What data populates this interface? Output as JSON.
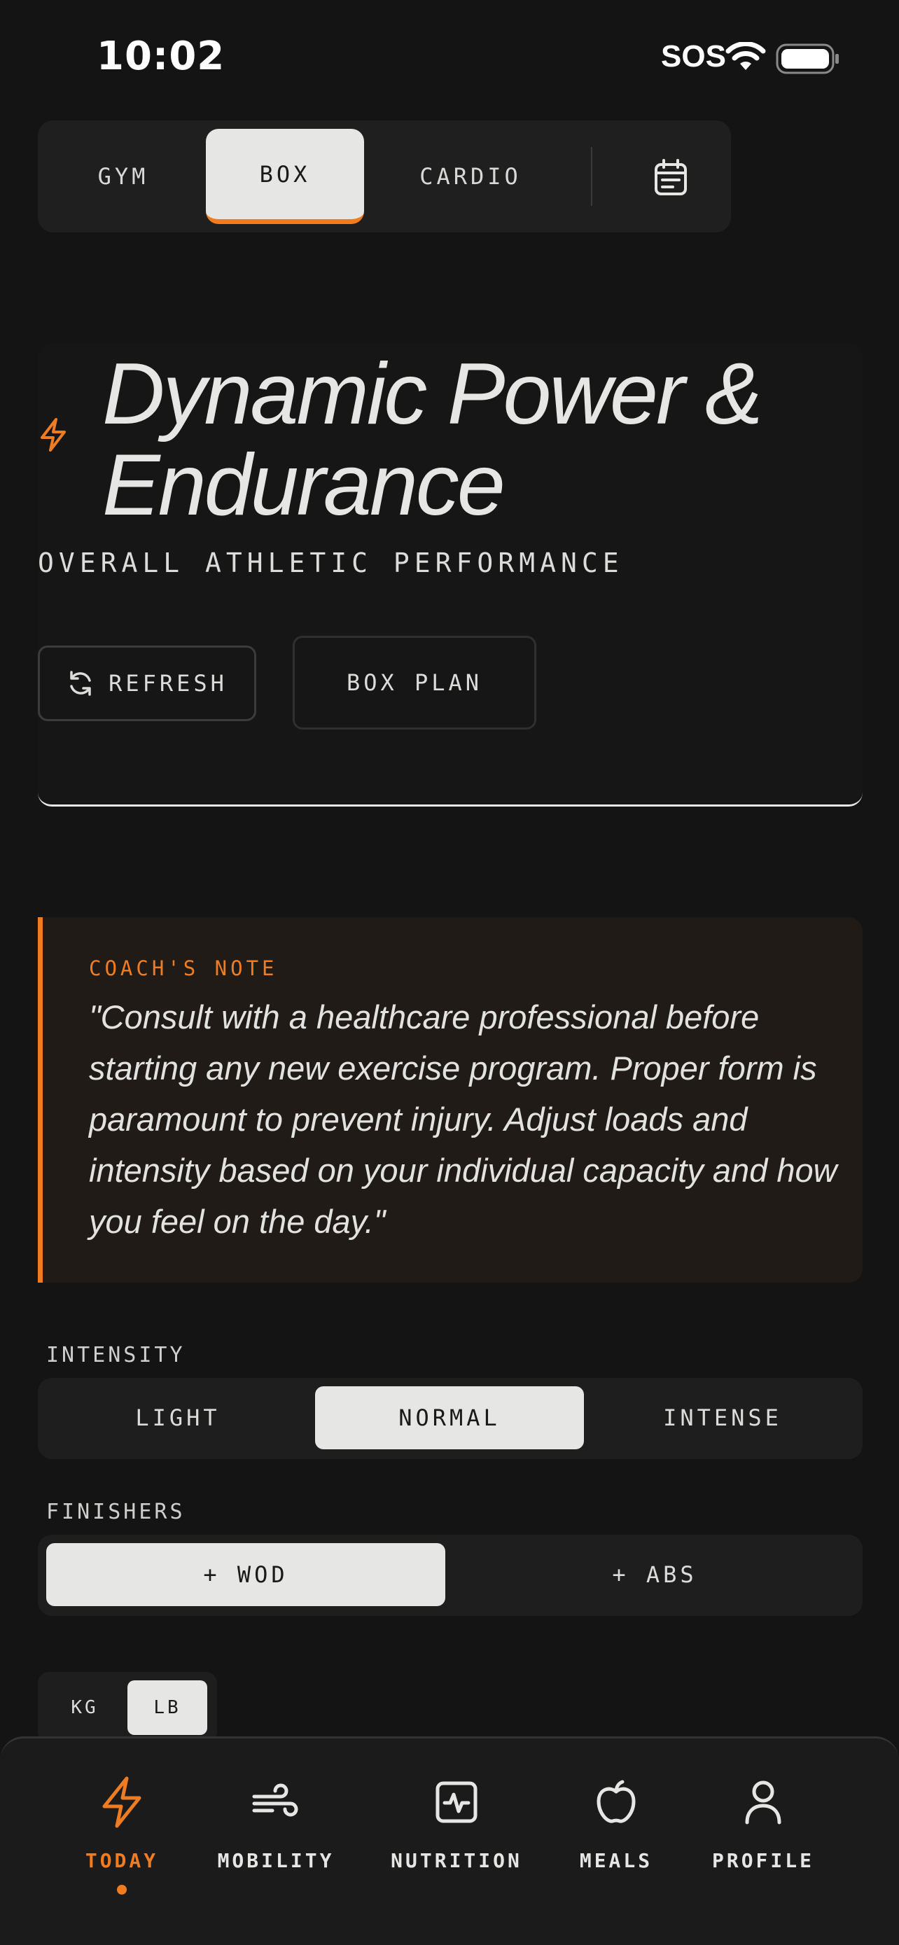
{
  "status_bar": {
    "time": "10:02",
    "sos": "SOS"
  },
  "top_tabs": {
    "items": [
      "GYM",
      "BOX",
      "CARDIO"
    ],
    "active": "BOX"
  },
  "hero": {
    "title": "Dynamic Power & Endurance",
    "subtitle": "OVERALL ATHLETIC PERFORMANCE",
    "refresh_label": "REFRESH",
    "plan_label": "BOX PLAN"
  },
  "coach_note": {
    "label": "COACH'S NOTE",
    "text": "\"Consult with a healthcare professional before starting any new exercise program. Proper form is paramount to prevent injury. Adjust loads and intensity based on your individual capacity and how you feel on the day.\""
  },
  "intensity": {
    "label": "INTENSITY",
    "options": [
      "LIGHT",
      "NORMAL",
      "INTENSE"
    ],
    "selected": "NORMAL"
  },
  "finishers": {
    "label": "FINISHERS",
    "options": [
      "+ WOD",
      "+ ABS"
    ],
    "selected": "+ WOD"
  },
  "units": {
    "options": [
      "KG",
      "LB"
    ],
    "selected": "LB"
  },
  "bottom_nav": {
    "items": [
      "TODAY",
      "MOBILITY",
      "NUTRITION",
      "MEALS",
      "PROFILE"
    ],
    "active": "TODAY"
  },
  "colors": {
    "accent": "#f07c22",
    "background": "#141414",
    "surface": "#1f1f1f",
    "active_fill": "#e6e6e4"
  }
}
